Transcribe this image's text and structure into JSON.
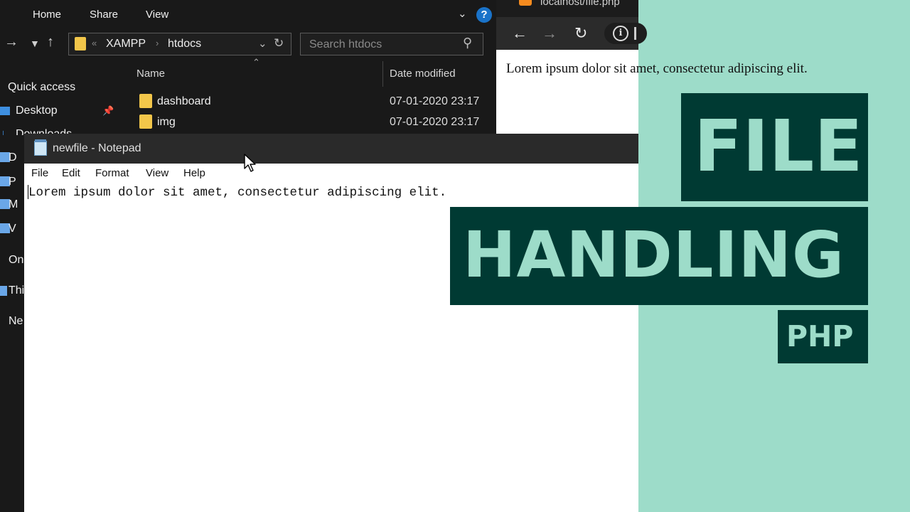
{
  "explorer": {
    "ribbon_tabs": [
      "Home",
      "Share",
      "View"
    ],
    "breadcrumb": [
      "XAMPP",
      "htdocs"
    ],
    "search_placeholder": "Search htdocs",
    "columns": {
      "name": "Name",
      "date": "Date modified"
    },
    "nav_items": {
      "quick_access": "Quick access",
      "desktop": "Desktop",
      "downloads": "Downloads"
    },
    "files": [
      {
        "name": "dashboard",
        "date": "07-01-2020 23:17"
      },
      {
        "name": "img",
        "date": "07-01-2020 23:17"
      }
    ],
    "left_stub_labels": [
      "D",
      "P",
      "M",
      "V",
      "On",
      "Thi",
      "Ne"
    ]
  },
  "browser": {
    "tab_title": "localhost/file.php",
    "page_text": "Lorem ipsum dolor sit amet, consectetur adipiscing elit."
  },
  "notepad": {
    "title": "newfile - Notepad",
    "menu": [
      "File",
      "Edit",
      "Format",
      "View",
      "Help"
    ],
    "content": "Lorem ipsum dolor sit amet, consectetur adipiscing elit."
  },
  "overlay": {
    "line1": "FILE",
    "line2": "HANDLING",
    "line3": "PHP",
    "colors": {
      "panel": "#003a33",
      "text": "#9ddcc9",
      "background": "#9ddcc9"
    }
  }
}
